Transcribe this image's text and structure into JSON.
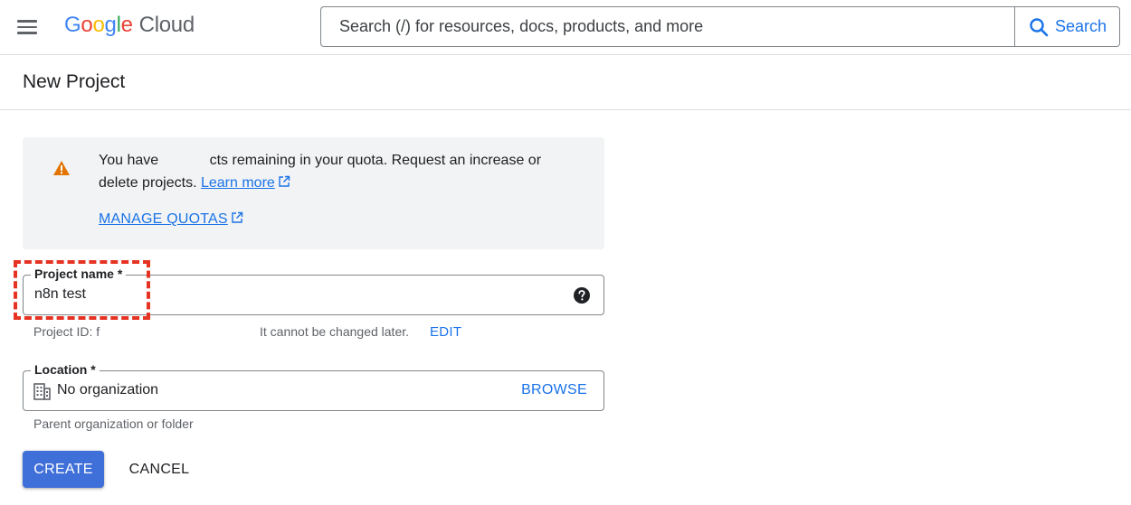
{
  "header": {
    "logo_letters": [
      "G",
      "o",
      "o",
      "g",
      "l",
      "e"
    ],
    "logo_product": "Cloud",
    "search_placeholder": "Search (/) for resources, docs, products, and more",
    "search_button_label": "Search"
  },
  "page": {
    "title": "New Project"
  },
  "quota_notice": {
    "text_before_redaction": "You have",
    "text_after_redaction": "cts remaining in your quota. Request an increase or delete projects.",
    "learn_more_label": "Learn more",
    "manage_quotas_label": "MANAGE QUOTAS"
  },
  "project_name": {
    "label": "Project name *",
    "value": "n8n test",
    "project_id_prefix": "Project ID: f",
    "id_note": "It cannot be changed later.",
    "edit_label": "EDIT"
  },
  "location": {
    "label": "Location *",
    "value": "No organization",
    "browse_label": "BROWSE",
    "hint": "Parent organization or folder"
  },
  "actions": {
    "create_label": "CREATE",
    "cancel_label": "CANCEL"
  },
  "icons": {
    "menu": "hamburger-menu-icon",
    "search": "search-icon",
    "warning": "warning-icon",
    "external_link": "external-link-icon",
    "help": "help-circle-icon",
    "organization": "organization-building-icon"
  },
  "colors": {
    "accent": "#1a73e8",
    "primary_button": "#3f6fd8",
    "warning": "#e37400",
    "highlight_dash": "#e53222",
    "notice_bg": "#f1f3f4"
  }
}
